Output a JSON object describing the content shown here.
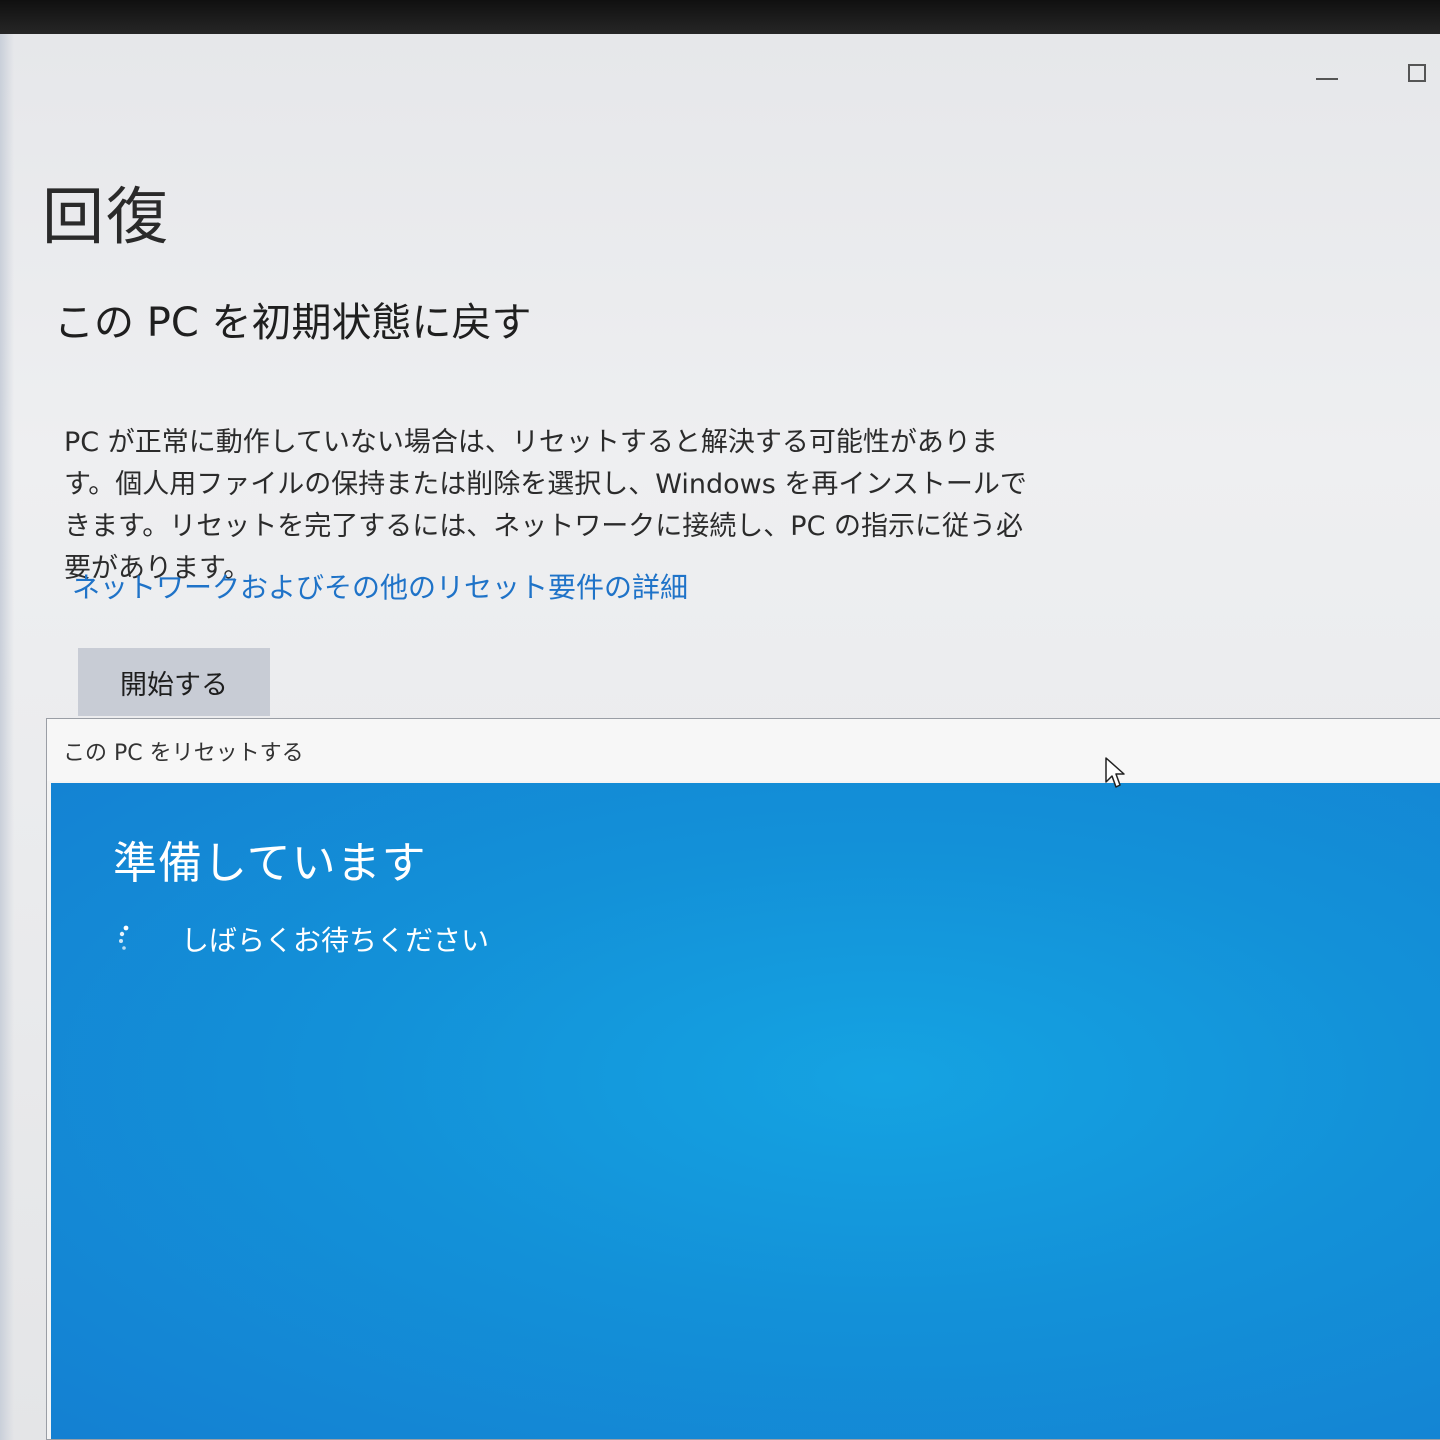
{
  "recovery_page": {
    "title": "回復",
    "section_heading": "この PC を初期状態に戻す",
    "description": "PC が正常に動作していない場合は、リセットすると解決する可能性があります。個人用ファイルの保持または削除を選択し、Windows を再インストールできます。リセットを完了するには、ネットワークに接続し、PC の指示に従う必要があります。",
    "link_text": "ネットワークおよびその他のリセット要件の詳細",
    "start_button_label": "開始する"
  },
  "reset_dialog": {
    "title": "この PC をリセットする",
    "heading": "準備しています",
    "status_text": "しばらくお待ちください"
  },
  "colors": {
    "link": "#1f73c8",
    "dialog_background": "#1391d8",
    "button_background": "#c8ccd5"
  }
}
